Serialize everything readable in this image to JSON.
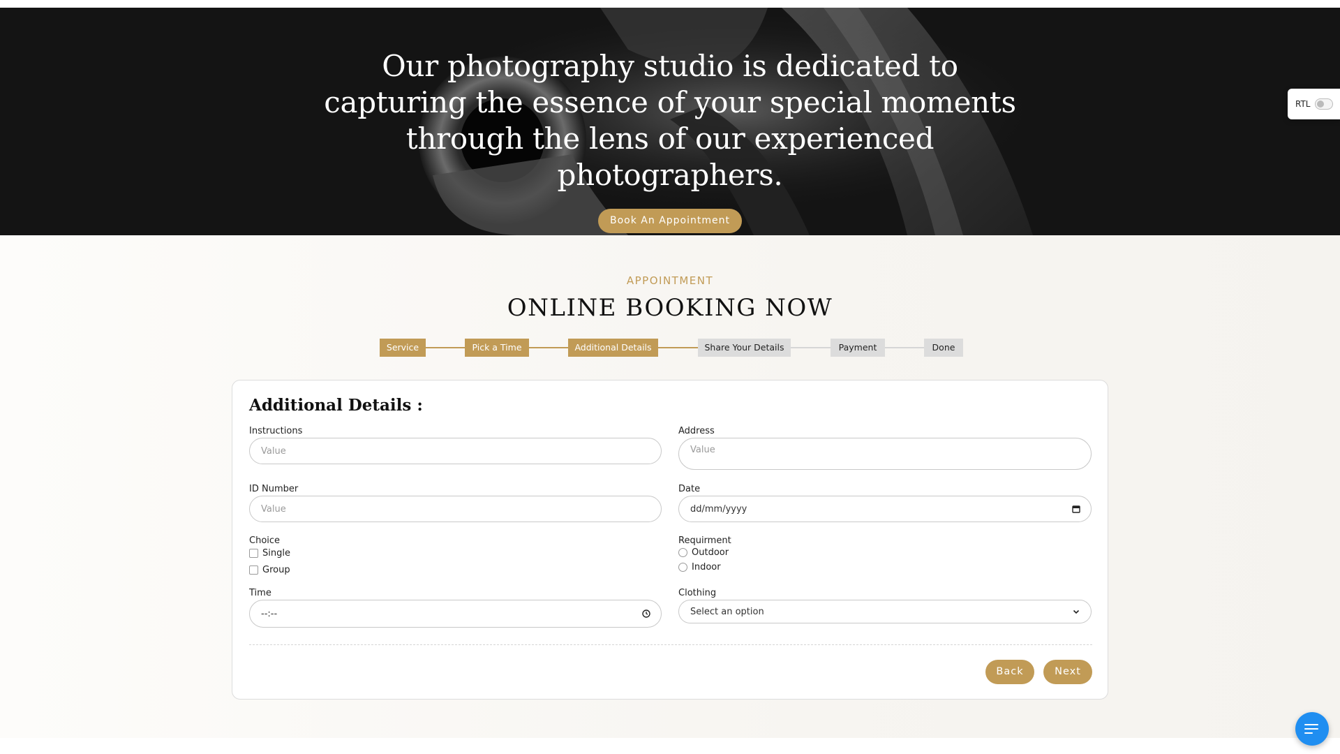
{
  "hero": {
    "text": "Our photography studio is dedicated to capturing the essence of your special moments through the lens of our experienced photographers.",
    "button_label": "Book An Appointment"
  },
  "rtl": {
    "label": "RTL",
    "enabled": false
  },
  "booking": {
    "eyebrow": "APPOINTMENT",
    "title": "ONLINE BOOKING NOW",
    "steps": [
      {
        "label": "Service",
        "status": "completed"
      },
      {
        "label": "Pick a Time",
        "status": "completed"
      },
      {
        "label": "Additional Details",
        "status": "current"
      },
      {
        "label": "Share Your Details",
        "status": "pending"
      },
      {
        "label": "Payment",
        "status": "pending"
      },
      {
        "label": "Done",
        "status": "pending"
      }
    ]
  },
  "form": {
    "heading": "Additional Details :",
    "instructions": {
      "label": "Instructions",
      "placeholder": "Value"
    },
    "address": {
      "label": "Address",
      "placeholder": "Value"
    },
    "id_number": {
      "label": "ID Number",
      "placeholder": "Value"
    },
    "date": {
      "label": "Date",
      "value": "dd/mm/yyyy"
    },
    "choice": {
      "label": "Choice",
      "options": [
        {
          "label": "Single",
          "checked": false
        },
        {
          "label": "Group",
          "checked": false
        }
      ]
    },
    "requirement": {
      "label": "Requirment",
      "options": [
        {
          "label": "Outdoor",
          "selected": false
        },
        {
          "label": "Indoor",
          "selected": false
        }
      ]
    },
    "time": {
      "label": "Time",
      "value": "--:--"
    },
    "clothing": {
      "label": "Clothing",
      "value": "Select an option"
    },
    "back_label": "Back",
    "next_label": "Next"
  },
  "colors": {
    "accent": "#c19b56",
    "step_pending": "#dcdcdc",
    "chat_fab": "#1f8ef1",
    "hero_bg": "#161616"
  },
  "icons": {
    "date": "calendar-icon",
    "time": "clock-icon",
    "clothing": "chevron-down-icon",
    "chat": "chat-lines-icon"
  }
}
